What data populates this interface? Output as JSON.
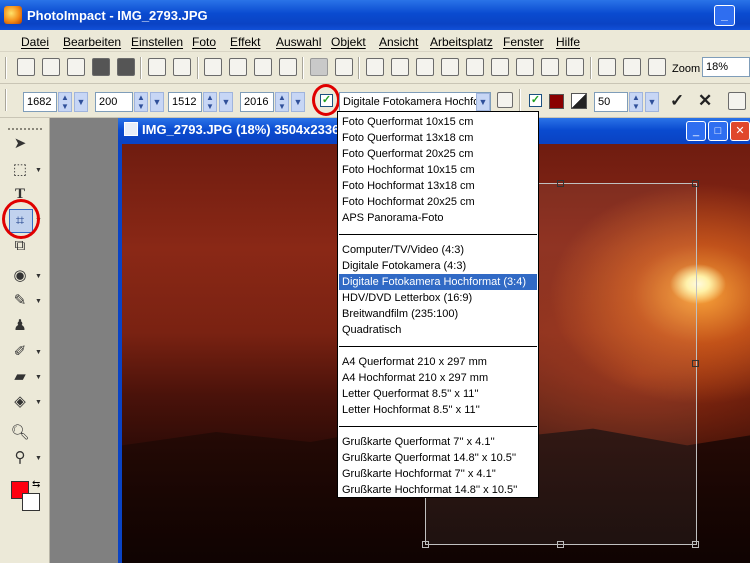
{
  "app": {
    "title": "PhotoImpact - IMG_2793.JPG",
    "minimize": "_"
  },
  "menu": [
    "Datei",
    "Bearbeiten",
    "Einstellen",
    "Foto",
    "Effekt",
    "Auswahl",
    "Objekt",
    "Ansicht",
    "Arbeitsplatz",
    "Fenster",
    "Hilfe"
  ],
  "toolbar": {
    "zoom_label": "Zoom",
    "zoom_value": "18%"
  },
  "crop_options": {
    "left": "1682",
    "top": "200",
    "width": "1512",
    "height": "2016",
    "fixed_ratio_checked": "✓",
    "preset_selected": "Digitale Fotokamera Hochformat (3:4)",
    "shade_checked": "✓",
    "shade_color": "#8a0000",
    "opacity": "50",
    "ok_icon": "checkmark-icon",
    "cancel_icon": "x-icon"
  },
  "document": {
    "title": "IMG_2793.JPG (18%) 3504x2336",
    "close": "✕",
    "max": "□",
    "min": "_"
  },
  "preset_list": {
    "groups": [
      [
        "Foto Querformat 10x15 cm",
        "Foto Querformat 13x18 cm",
        "Foto Querformat 20x25 cm",
        "Foto Hochformat 10x15 cm",
        "Foto Hochformat 13x18 cm",
        "Foto Hochformat 20x25 cm",
        "APS Panorama-Foto"
      ],
      [
        "Computer/TV/Video (4:3)",
        "Digitale Fotokamera (4:3)",
        "Digitale Fotokamera Hochformat (3:4)",
        "HDV/DVD Letterbox (16:9)",
        "Breitwandfilm (235:100)",
        "Quadratisch"
      ],
      [
        "A4 Querformat 210 x 297 mm",
        "A4 Hochformat 210 x 297 mm",
        "Letter Querformat 8.5'' x 11''",
        "Letter Hochformat 8.5'' x 11''"
      ],
      [
        "Grußkarte Querformat 7'' x 4.1''",
        "Grußkarte Querformat 14.8'' x 10.5''",
        "Grußkarte Hochformat 7'' x 4.1''",
        "Grußkarte Hochformat 14.8'' x 10.5''"
      ]
    ],
    "selected": "Digitale Fotokamera Hochformat (3:4)"
  },
  "colors": {
    "foreground": "#ff0010",
    "background": "#ffffff",
    "highlight": "#316ac5",
    "annotation_circle": "#e00000"
  }
}
